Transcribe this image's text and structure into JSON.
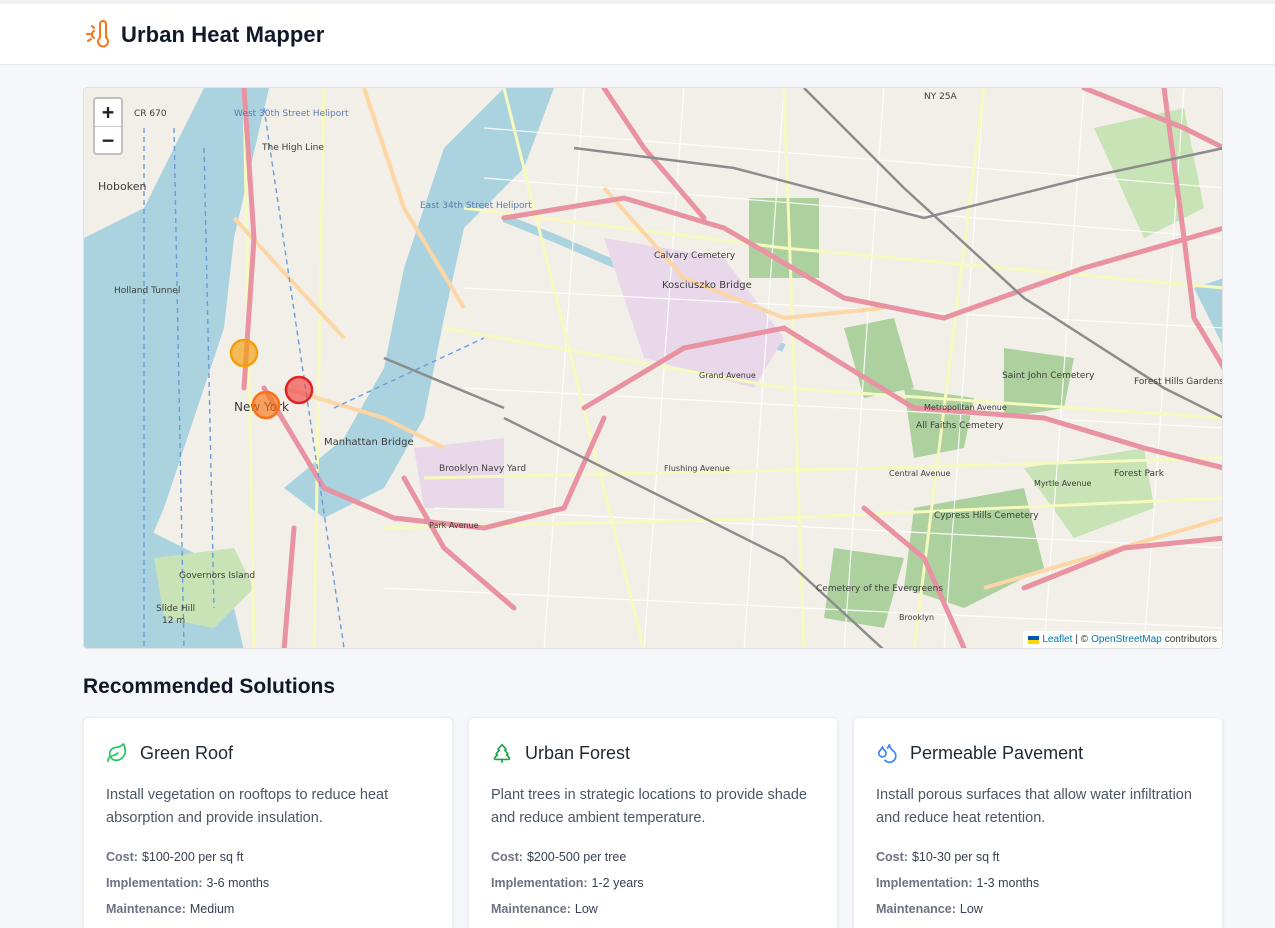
{
  "app": {
    "title": "Urban Heat Mapper",
    "logo_icon": "thermometer-sun-icon",
    "accent": "#f97316"
  },
  "map": {
    "zoom_in_label": "+",
    "zoom_out_label": "−",
    "place_labels": [
      "Hoboken",
      "The High Line",
      "West 30th Street Heliport",
      "CR 670",
      "Holland Tunnel",
      "New York",
      "Manhattan Bridge",
      "East 34th Street Heliport",
      "Calvary Cemetery",
      "Kosciuszko Bridge",
      "Brooklyn Navy Yard",
      "Governors Island",
      "Slide Hill",
      "12 m",
      "Saint John Cemetery",
      "All Faiths Cemetery",
      "Cypress Hills Cemetery",
      "Cemetery of the Evergreens",
      "Forest Park",
      "Forest Hills Gardens",
      "NY 25A",
      "Metropolitan Avenue",
      "Myrtle Avenue",
      "Flushing Avenue",
      "Grand Avenue",
      "Central Avenue",
      "Park Avenue",
      "Brooklyn"
    ],
    "heat_markers": [
      {
        "level": "moderate",
        "color": "#f59e0b"
      },
      {
        "level": "high",
        "color": "#ef4444"
      },
      {
        "level": "elevated",
        "color": "#f97316"
      }
    ],
    "attribution": {
      "leaflet": "Leaflet",
      "separator": "| ©",
      "osm": "OpenStreetMap",
      "suffix": "contributors"
    }
  },
  "solutions": {
    "heading": "Recommended Solutions",
    "cost_label": "Cost:",
    "implementation_label": "Implementation:",
    "maintenance_label": "Maintenance:",
    "items": [
      {
        "icon": "leaf-icon",
        "icon_color": "#22c55e",
        "title": "Green Roof",
        "description": "Install vegetation on rooftops to reduce heat absorption and provide insulation.",
        "cost": "$100-200 per sq ft",
        "implementation": "3-6 months",
        "maintenance": "Medium"
      },
      {
        "icon": "tree-icon",
        "icon_color": "#16a34a",
        "title": "Urban Forest",
        "description": "Plant trees in strategic locations to provide shade and reduce ambient temperature.",
        "cost": "$200-500 per tree",
        "implementation": "1-2 years",
        "maintenance": "Low"
      },
      {
        "icon": "droplets-icon",
        "icon_color": "#3b82f6",
        "title": "Permeable Pavement",
        "description": "Install porous surfaces that allow water infiltration and reduce heat retention.",
        "cost": "$10-30 per sq ft",
        "implementation": "1-3 months",
        "maintenance": "Low"
      }
    ]
  }
}
